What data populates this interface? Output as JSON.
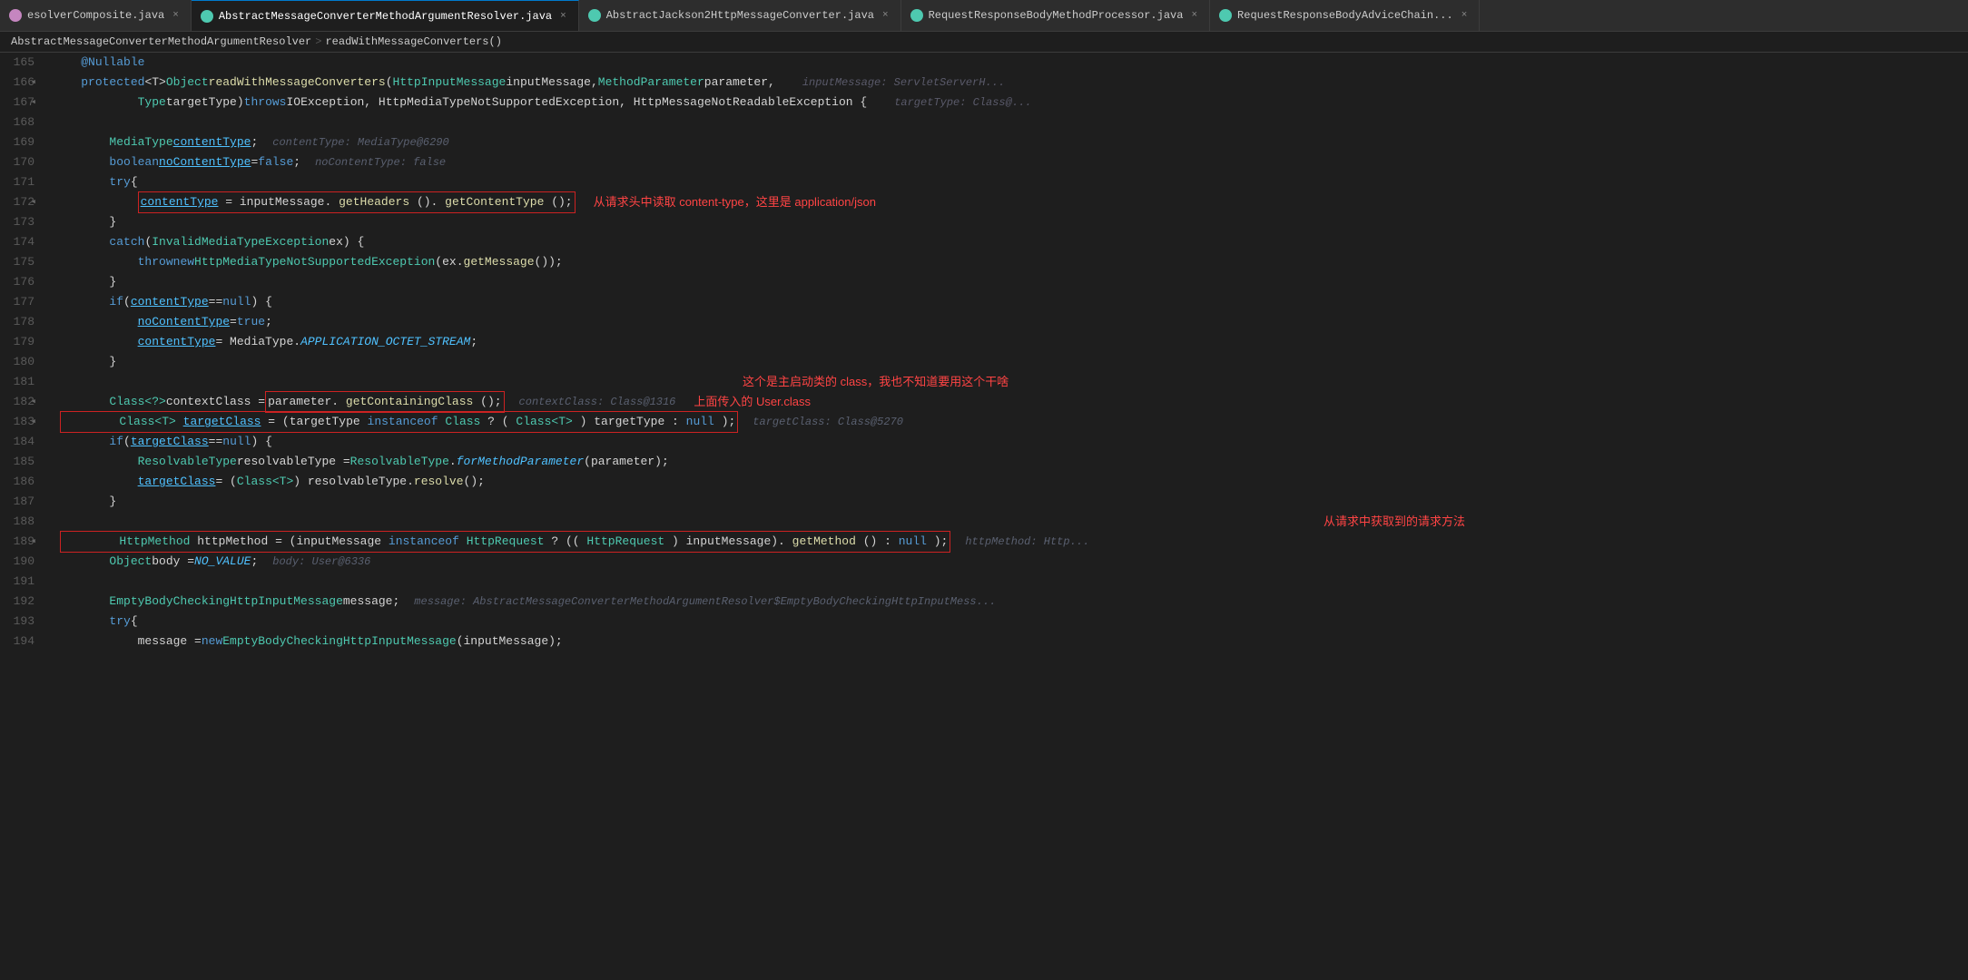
{
  "tabs": [
    {
      "id": "tab1",
      "icon_color": "#c586c0",
      "label": "esolverComposite.java",
      "active": false,
      "show_close": true
    },
    {
      "id": "tab2",
      "icon_color": "#4ec9b0",
      "label": "AbstractMessageConverterMethodArgumentResolver.java",
      "active": true,
      "show_close": true
    },
    {
      "id": "tab3",
      "icon_color": "#4ec9b0",
      "label": "AbstractJackson2HttpMessageConverter.java",
      "active": false,
      "show_close": true
    },
    {
      "id": "tab4",
      "icon_color": "#4ec9b0",
      "label": "RequestResponseBodyMethodProcessor.java",
      "active": false,
      "show_close": true
    },
    {
      "id": "tab5",
      "icon_color": "#4ec9b0",
      "label": "RequestResponseBodyAdviceChai...",
      "active": false,
      "show_close": true
    }
  ],
  "breadcrumb": {
    "class": "AbstractMessageConverterMethodArgumentResolver",
    "sep": ">",
    "method": "readWithMessageConverters()"
  },
  "lines": [
    {
      "num": 165,
      "content": "    @Nullable",
      "type": "annotation"
    },
    {
      "num": 166,
      "content": "    protected <T> Object readWithMessageConverters(...)",
      "type": "code"
    },
    {
      "num": 167,
      "content": "            Type targetType) throws IOException, HttpMediaTypeNotSupportedException, HttpMessageNotReadableException {",
      "type": "code"
    },
    {
      "num": 168,
      "content": "",
      "type": "empty"
    },
    {
      "num": 169,
      "content": "        MediaType contentType;     contentType: MediaType@6290",
      "type": "code"
    },
    {
      "num": 170,
      "content": "        boolean noContentType = false;   noContentType: false",
      "type": "code"
    },
    {
      "num": 171,
      "content": "        try {",
      "type": "code"
    },
    {
      "num": 172,
      "content": "            contentType = inputMessage.getHeaders().getContentType();",
      "type": "code_boxed",
      "annotation": "从请求头中读取 content-type，这里是 application/json"
    },
    {
      "num": 173,
      "content": "        }",
      "type": "code"
    },
    {
      "num": 174,
      "content": "        catch (InvalidMediaTypeException ex) {",
      "type": "code"
    },
    {
      "num": 175,
      "content": "            throw new HttpMediaTypeNotSupportedException(ex.getMessage());",
      "type": "code"
    },
    {
      "num": 176,
      "content": "        }",
      "type": "code"
    },
    {
      "num": 177,
      "content": "        if (contentType == null) {",
      "type": "code"
    },
    {
      "num": 178,
      "content": "            noContentType = true;",
      "type": "code"
    },
    {
      "num": 179,
      "content": "            contentType = MediaType.APPLICATION_OCTET_STREAM;",
      "type": "code"
    },
    {
      "num": 180,
      "content": "        }",
      "type": "code"
    },
    {
      "num": 181,
      "content": "",
      "type": "empty",
      "annotation": "这个是主启动类的 class，我也不知道要用这个干啥"
    },
    {
      "num": 182,
      "content": "        Class<?> contextClass = parameter.getContainingClass();",
      "type": "code_boxed2",
      "hint": "contextClass: Class@1316",
      "annotation2": "上面传入的 User.class"
    },
    {
      "num": 183,
      "content": "        Class<T> targetClass = (targetType instanceof Class ? (Class<T>) targetType : null);",
      "type": "code_boxed3",
      "hint": "targetClass: Class@5270"
    },
    {
      "num": 184,
      "content": "        if (targetClass == null) {",
      "type": "code"
    },
    {
      "num": 185,
      "content": "            ResolvableType resolvableType = ResolvableType.forMethodParameter(parameter);",
      "type": "code"
    },
    {
      "num": 186,
      "content": "            targetClass = (Class<T>) resolvableType.resolve();",
      "type": "code"
    },
    {
      "num": 187,
      "content": "        }",
      "type": "code"
    },
    {
      "num": 188,
      "content": "",
      "type": "empty",
      "annotation3": "从请求中获取到的请求方法"
    },
    {
      "num": 189,
      "content": "        HttpMethod httpMethod = (inputMessage instanceof HttpRequest ? ((HttpRequest) inputMessage).getMethod() : null);",
      "type": "code_boxed4",
      "hint3": "httpMethod: Http..."
    },
    {
      "num": 190,
      "content": "        Object body = NO_VALUE;   body: User@6336",
      "type": "code"
    },
    {
      "num": 191,
      "content": "",
      "type": "empty"
    },
    {
      "num": 192,
      "content": "        EmptyBodyCheckingHttpInputMessage message;   message: AbstractMessageConverterMethodArgumentResolver$EmptyBodyCheckingHttpInputMess...",
      "type": "code"
    },
    {
      "num": 193,
      "content": "        try {",
      "type": "code"
    },
    {
      "num": 194,
      "content": "            message = new EmptyBodyCheckingHttpInputMessage(inputMessage);",
      "type": "code"
    }
  ]
}
